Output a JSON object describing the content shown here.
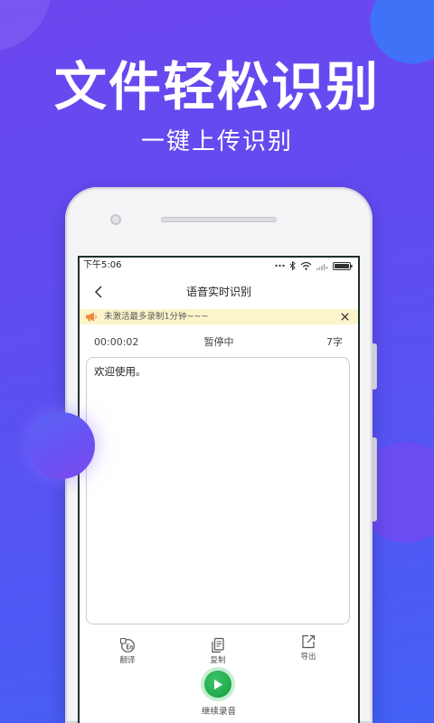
{
  "promo": {
    "title": "文件轻松识别",
    "subtitle": "一键上传识别"
  },
  "status_bar": {
    "time": "下午5:06",
    "icons": [
      "more-dots-icon",
      "bluetooth-icon",
      "wifi-icon",
      "signal-icon",
      "battery-icon"
    ]
  },
  "nav": {
    "back_icon": "chevron-left-icon",
    "title": "语音实时识别"
  },
  "banner": {
    "icon": "speaker-icon",
    "text": "未激活最多录制1分钟~~~",
    "close_icon": "close-icon"
  },
  "recording": {
    "elapsed": "00:00:02",
    "state": "暂停中",
    "char_count": "7字"
  },
  "transcript": {
    "text": "欢迎使用。"
  },
  "toolbar": {
    "items": [
      {
        "icon": "translate-icon",
        "label": "翻译"
      },
      {
        "icon": "copy-icon",
        "label": "复制"
      },
      {
        "icon": "export-icon",
        "label": "导出"
      }
    ]
  },
  "record_button": {
    "icon": "play-icon",
    "label": "继续录音"
  },
  "colors": {
    "bg_top": "#6c46ee",
    "bg_bottom": "#4360f5",
    "accent_green": "#22a94c",
    "banner_bg": "#fcf4cb",
    "banner_icon": "#f08a3c"
  }
}
